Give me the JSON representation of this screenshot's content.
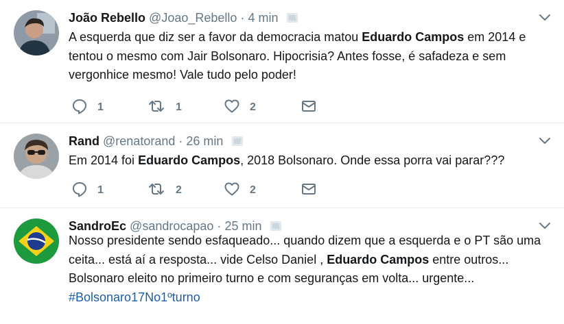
{
  "tweets": [
    {
      "name": "João Rebello",
      "handle": "@Joao_Rebello",
      "separator": "·",
      "time": "4 min",
      "text": [
        {
          "t": "A esquerda que diz ser a favor da democracia matou "
        },
        {
          "t": "Eduardo Campos",
          "bold": true
        },
        {
          "t": " em 2014 e tentou o mesmo com Jair Bolsonaro. Hipocrisia? Antes fosse, é safadeza e sem vergonhice mesmo! Vale tudo pelo poder!"
        }
      ],
      "replies": "1",
      "retweets": "1",
      "likes": "2"
    },
    {
      "name": "Rand",
      "handle": "@renatorand",
      "separator": "·",
      "time": "26 min",
      "text": [
        {
          "t": "Em 2014 foi "
        },
        {
          "t": "Eduardo Campos",
          "bold": true
        },
        {
          "t": ", 2018 Bolsonaro. Onde essa porra vai parar???"
        }
      ],
      "replies": "1",
      "retweets": "2",
      "likes": "2"
    },
    {
      "name": "SandroEc",
      "handle": "@sandrocapao",
      "separator": "·",
      "time": "25 min",
      "text": [
        {
          "t": "Nosso presidente sendo esfaqueado... quando dizem que a esquerda e o PT são uma ceita... está aí a resposta... vide Celso Daniel , "
        },
        {
          "t": "Eduardo Campos",
          "bold": true
        },
        {
          "t": " entre outros... Bolsonaro eleito no primeiro turno e com seguranças em volta... urgente... "
        },
        {
          "t": "#Bolsonaro17No1ºturno",
          "hashtag": true
        }
      ]
    }
  ],
  "colors": {
    "text": "#14171a",
    "muted": "#657786",
    "hashtag": "#1b5ea6",
    "divider": "#e6ecf0"
  }
}
